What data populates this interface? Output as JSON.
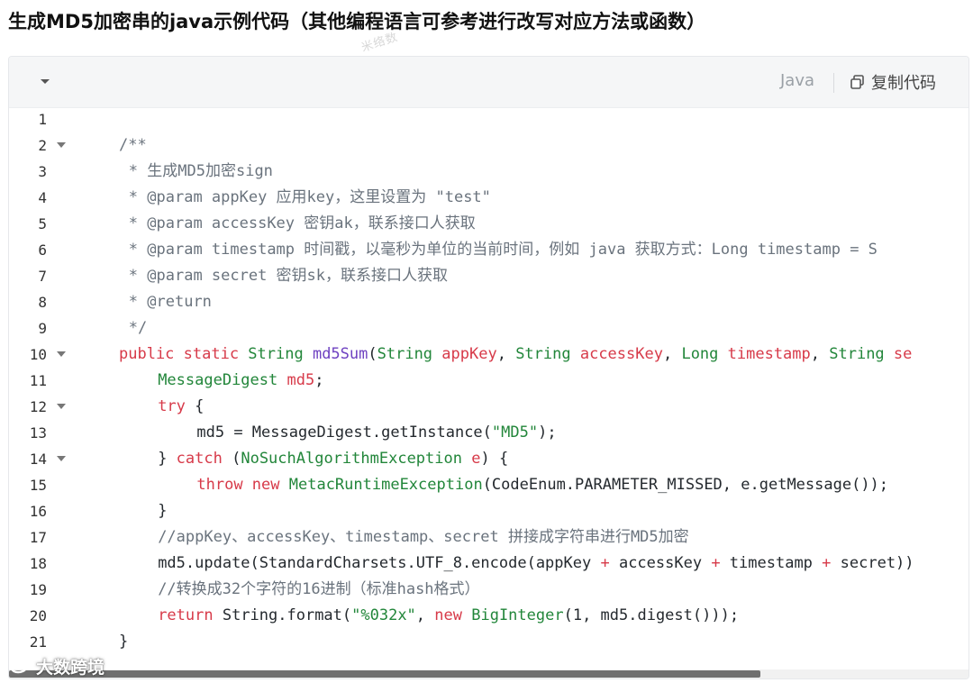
{
  "page": {
    "title": "生成MD5加密串的java示例代码（其他编程语言可参考进行改写对应方法或函数）",
    "faint_watermark": "米络数"
  },
  "code_block": {
    "language": "Java",
    "copy_label": "复制代码",
    "icons": {
      "collapse": "chevron-down-icon",
      "copy": "copy-icon",
      "fold": "fold-arrow-icon"
    },
    "colors": {
      "comment": "#6a737d",
      "keyword": "#d73a49",
      "type": "#22863a",
      "string": "#22863a",
      "header_bg": "#f5f6f7"
    },
    "lines": [
      {
        "n": "1",
        "indent": 0,
        "foldable": false,
        "tokens": []
      },
      {
        "n": "2",
        "indent": 4,
        "foldable": true,
        "tokens": [
          {
            "t": "/**",
            "c": "comment"
          }
        ]
      },
      {
        "n": "3",
        "indent": 5,
        "foldable": false,
        "tokens": [
          {
            "t": "* 生成MD5加密sign",
            "c": "comment"
          }
        ]
      },
      {
        "n": "4",
        "indent": 5,
        "foldable": false,
        "tokens": [
          {
            "t": "* @param appKey 应用key，这里设置为 \"test\"",
            "c": "comment"
          }
        ]
      },
      {
        "n": "5",
        "indent": 5,
        "foldable": false,
        "tokens": [
          {
            "t": "* @param accessKey 密钥ak，联系接口人获取",
            "c": "comment"
          }
        ]
      },
      {
        "n": "6",
        "indent": 5,
        "foldable": false,
        "tokens": [
          {
            "t": "* @param timestamp 时间戳，以毫秒为单位的当前时间，例如 java 获取方式：Long timestamp = S",
            "c": "comment"
          }
        ]
      },
      {
        "n": "7",
        "indent": 5,
        "foldable": false,
        "tokens": [
          {
            "t": "* @param secret 密钥sk，联系接口人获取",
            "c": "comment"
          }
        ]
      },
      {
        "n": "8",
        "indent": 5,
        "foldable": false,
        "tokens": [
          {
            "t": "* @return",
            "c": "comment"
          }
        ]
      },
      {
        "n": "9",
        "indent": 5,
        "foldable": false,
        "tokens": [
          {
            "t": "*/",
            "c": "comment"
          }
        ]
      },
      {
        "n": "10",
        "indent": 4,
        "foldable": true,
        "tokens": [
          {
            "t": "public static ",
            "c": "keyword"
          },
          {
            "t": "String ",
            "c": "type"
          },
          {
            "t": "md5Sum",
            "c": "func"
          },
          {
            "t": "(",
            "c": "plain"
          },
          {
            "t": "String ",
            "c": "type"
          },
          {
            "t": "appKey",
            "c": "keyword"
          },
          {
            "t": ", ",
            "c": "plain"
          },
          {
            "t": "String ",
            "c": "type"
          },
          {
            "t": "accessKey",
            "c": "keyword"
          },
          {
            "t": ", ",
            "c": "plain"
          },
          {
            "t": "Long ",
            "c": "type"
          },
          {
            "t": "timestamp",
            "c": "keyword"
          },
          {
            "t": ", ",
            "c": "plain"
          },
          {
            "t": "String ",
            "c": "type"
          },
          {
            "t": "se",
            "c": "keyword"
          }
        ]
      },
      {
        "n": "11",
        "indent": 8,
        "foldable": false,
        "tokens": [
          {
            "t": "MessageDigest ",
            "c": "type"
          },
          {
            "t": "md5",
            "c": "keyword"
          },
          {
            "t": ";",
            "c": "plain"
          }
        ]
      },
      {
        "n": "12",
        "indent": 8,
        "foldable": true,
        "tokens": [
          {
            "t": "try",
            "c": "keyword"
          },
          {
            "t": " {",
            "c": "plain"
          }
        ]
      },
      {
        "n": "13",
        "indent": 12,
        "foldable": false,
        "tokens": [
          {
            "t": "md5 = MessageDigest.getInstance(",
            "c": "plain"
          },
          {
            "t": "\"MD5\"",
            "c": "string"
          },
          {
            "t": ");",
            "c": "plain"
          }
        ]
      },
      {
        "n": "14",
        "indent": 8,
        "foldable": true,
        "tokens": [
          {
            "t": "} ",
            "c": "plain"
          },
          {
            "t": "catch",
            "c": "keyword"
          },
          {
            "t": " (",
            "c": "plain"
          },
          {
            "t": "NoSuchAlgorithmException ",
            "c": "type"
          },
          {
            "t": "e",
            "c": "keyword"
          },
          {
            "t": ") {",
            "c": "plain"
          }
        ]
      },
      {
        "n": "15",
        "indent": 12,
        "foldable": false,
        "tokens": [
          {
            "t": "throw new ",
            "c": "keyword"
          },
          {
            "t": "MetacRuntimeException",
            "c": "type"
          },
          {
            "t": "(CodeEnum.PARAMETER_MISSED, e.getMessage());",
            "c": "plain"
          }
        ]
      },
      {
        "n": "16",
        "indent": 8,
        "foldable": false,
        "tokens": [
          {
            "t": "}",
            "c": "plain"
          }
        ]
      },
      {
        "n": "17",
        "indent": 8,
        "foldable": false,
        "tokens": [
          {
            "t": "//appKey、accessKey、timestamp、secret 拼接成字符串进行MD5加密",
            "c": "comment"
          }
        ]
      },
      {
        "n": "18",
        "indent": 8,
        "foldable": false,
        "tokens": [
          {
            "t": "md5.update(StandardCharsets.UTF_8.encode(appKey ",
            "c": "plain"
          },
          {
            "t": "+",
            "c": "keyword"
          },
          {
            "t": " accessKey ",
            "c": "plain"
          },
          {
            "t": "+",
            "c": "keyword"
          },
          {
            "t": " timestamp ",
            "c": "plain"
          },
          {
            "t": "+",
            "c": "keyword"
          },
          {
            "t": " secret))",
            "c": "plain"
          }
        ]
      },
      {
        "n": "19",
        "indent": 8,
        "foldable": false,
        "tokens": [
          {
            "t": "//转换成32个字符的16进制（标准hash格式）",
            "c": "comment"
          }
        ]
      },
      {
        "n": "20",
        "indent": 8,
        "foldable": false,
        "tokens": [
          {
            "t": "return ",
            "c": "keyword"
          },
          {
            "t": "String.format(",
            "c": "plain"
          },
          {
            "t": "\"%032x\"",
            "c": "string"
          },
          {
            "t": ", ",
            "c": "plain"
          },
          {
            "t": "new ",
            "c": "keyword"
          },
          {
            "t": "BigInteger",
            "c": "type"
          },
          {
            "t": "(1, md5.digest()));",
            "c": "plain"
          }
        ]
      },
      {
        "n": "21",
        "indent": 4,
        "foldable": false,
        "tokens": [
          {
            "t": "}",
            "c": "plain"
          }
        ]
      }
    ]
  },
  "brand_watermark": {
    "text": "大数跨境"
  }
}
